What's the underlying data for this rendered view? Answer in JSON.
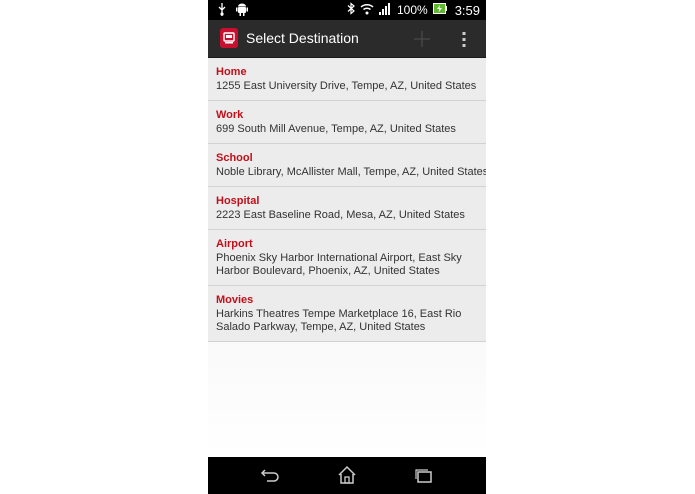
{
  "status_bar": {
    "battery": "100%",
    "time": "3:59"
  },
  "action_bar": {
    "title": "Select Destination"
  },
  "destinations": [
    {
      "name": "Home",
      "address": "1255 East University Drive, Tempe, AZ, United States"
    },
    {
      "name": "Work",
      "address": "699 South Mill Avenue, Tempe, AZ, United States"
    },
    {
      "name": "School",
      "address": "Noble Library, McAllister Mall, Tempe, AZ, United States"
    },
    {
      "name": "Hospital",
      "address": "2223 East Baseline Road, Mesa, AZ, United States"
    },
    {
      "name": "Airport",
      "address": "Phoenix Sky Harbor International Airport, East Sky Harbor Boulevard, Phoenix, AZ, United States"
    },
    {
      "name": "Movies",
      "address": "Harkins Theatres Tempe Marketplace 16, East Rio Salado Parkway, Tempe, AZ, United States"
    }
  ],
  "colors": {
    "accent": "#c0101a",
    "action_bar": "#2b2b2b",
    "list_background": "#ececec"
  }
}
